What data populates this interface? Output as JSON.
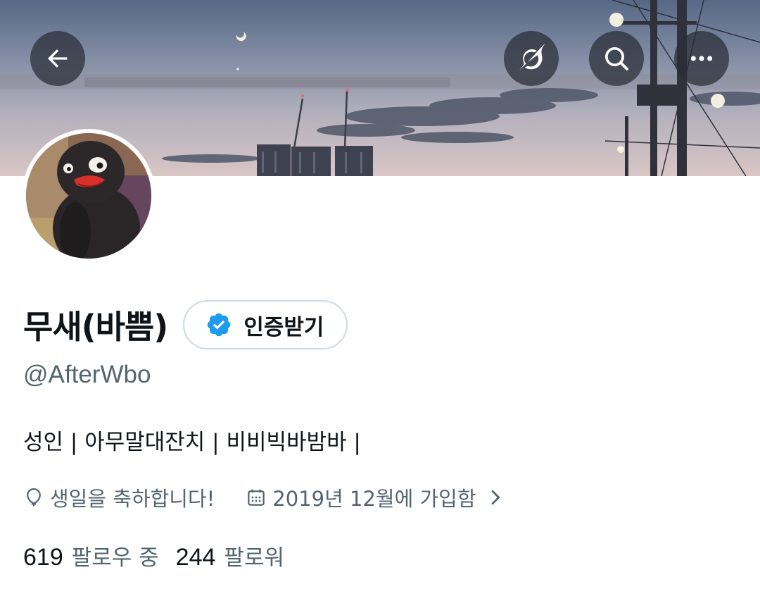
{
  "profile": {
    "display_name": "무새(바쁨)",
    "handle": "@AfterWbo",
    "bio": "성인 | 아무말대잔치 | 비비빅바밤바 |",
    "verify_button_label": "인증받기",
    "birthday_text": "생일을 축하합니다!",
    "join_date_text": "2019년 12월에 가입함"
  },
  "stats": {
    "following_count": "619",
    "following_label": "팔로우 중",
    "followers_count": "244",
    "followers_label": "팔로워"
  },
  "header_buttons": {
    "back": "back-arrow-icon",
    "grok": "grok-icon",
    "search": "search-icon",
    "more": "more-options-icon"
  },
  "colors": {
    "primary_text": "#0f1419",
    "secondary_text": "#536471",
    "verified_blue": "#1d9bf0",
    "button_border": "#cfd9de",
    "overlay_button": "#282c34"
  }
}
